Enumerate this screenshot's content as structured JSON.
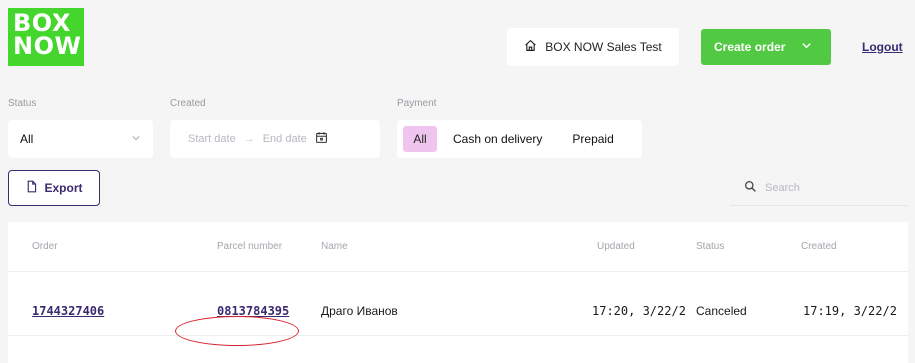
{
  "header": {
    "logo_line1": "BOX",
    "logo_line2": "NOW",
    "account_label": "BOX NOW Sales Test",
    "create_order_label": "Create order",
    "logout_label": "Logout"
  },
  "filters": {
    "status_label": "Status",
    "status_value": "All",
    "created_label": "Created",
    "start_placeholder": "Start date",
    "range_separator": "→",
    "end_placeholder": "End date",
    "payment_label": "Payment",
    "payment_options": [
      "All",
      "Cash on delivery",
      "Prepaid"
    ],
    "payment_selected": "All"
  },
  "toolbar": {
    "export_label": "Export",
    "search_placeholder": "Search"
  },
  "table": {
    "columns": [
      "Order",
      "Parcel number",
      "Name",
      "Updated",
      "Status",
      "Created"
    ],
    "rows": [
      {
        "order": "1744327406",
        "parcel_number": "0813784395",
        "name": "Драго Иванов",
        "updated": "17:20, 3/22/2",
        "status": "Canceled",
        "created": "17:19, 3/22/2"
      }
    ]
  },
  "colors": {
    "brand_green": "#44d62c",
    "create_button": "#51c943",
    "accent_purple": "#3a2a6f",
    "selected_pill": "#efc5f0",
    "annotation_red": "#d8262f"
  }
}
